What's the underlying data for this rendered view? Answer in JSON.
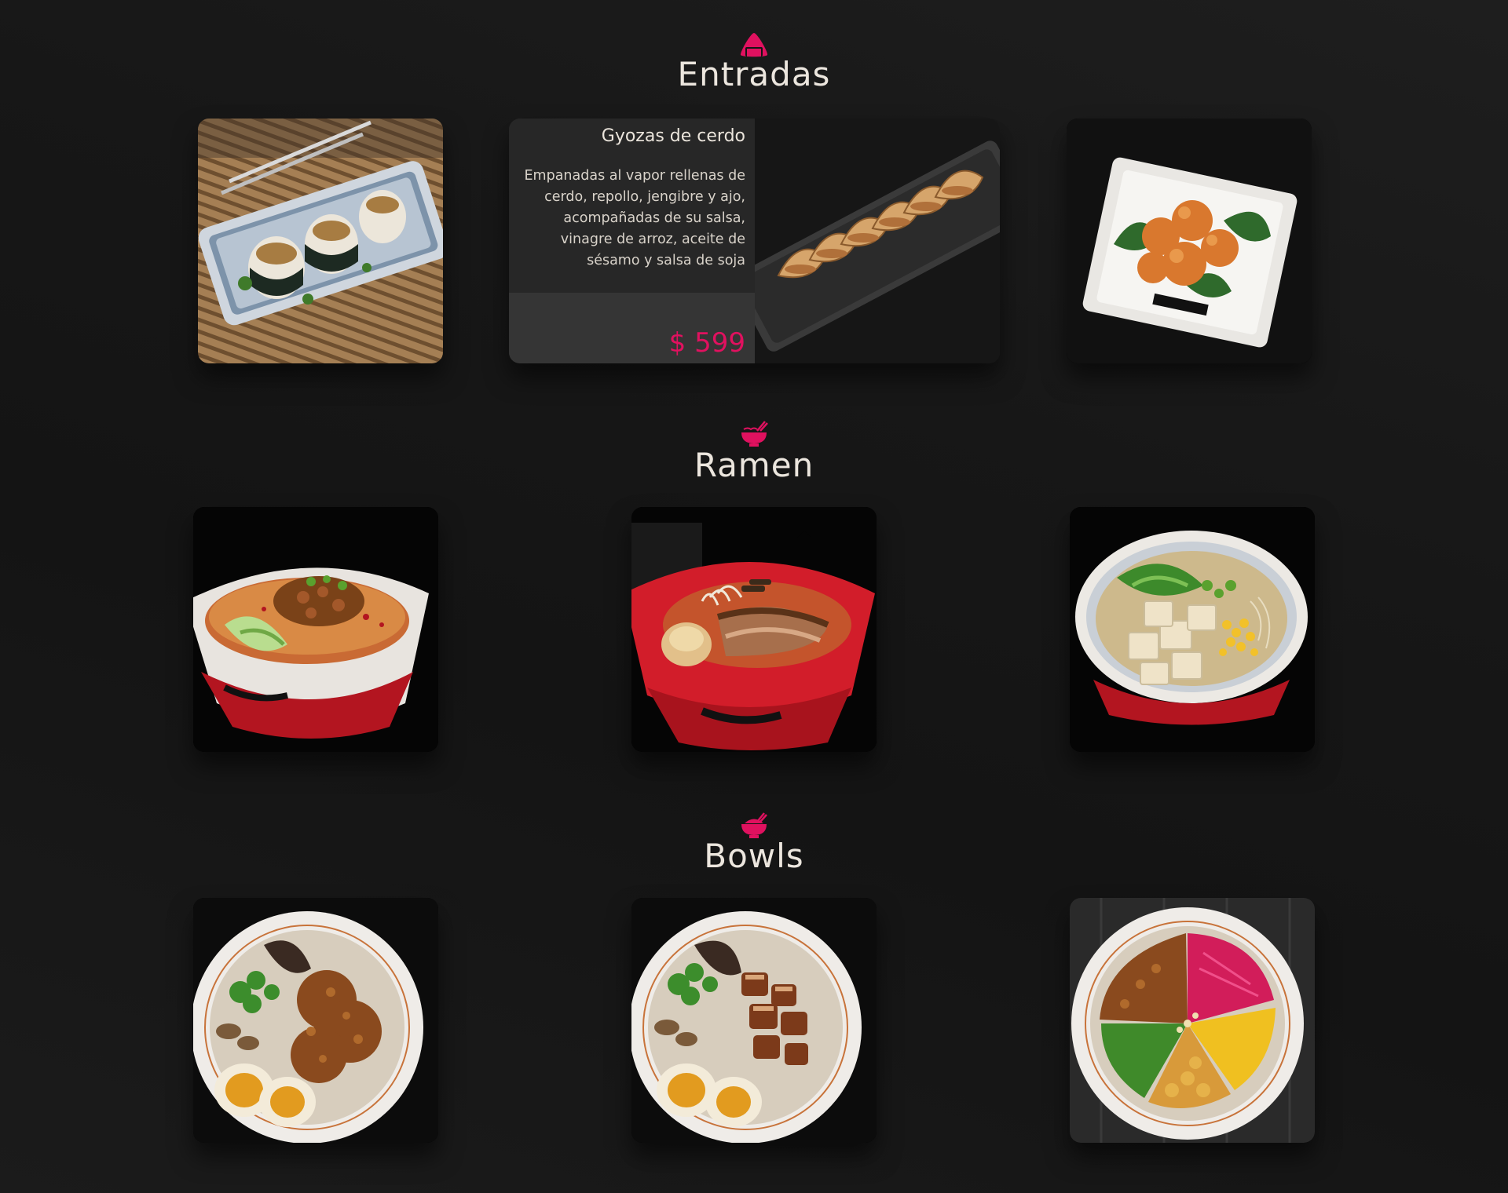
{
  "theme": {
    "accent": "#e0115f",
    "background": "#161616",
    "text": "#ece6de"
  },
  "sections": [
    {
      "title": "Entradas",
      "icon": "onigiri-icon",
      "items": [
        {
          "image": "onigiri-plate-photo"
        },
        {
          "image": "gyoza-plate-photo",
          "name": "Gyozas de cerdo",
          "description": "Empanadas al vapor rellenas de cerdo, repollo, jengibre y ajo, acompañadas de su salsa, vinagre de arroz, aceite de sésamo y salsa de soja",
          "price": "$ 599"
        },
        {
          "image": "fried-shrimp-plate-photo"
        }
      ]
    },
    {
      "title": "Ramen",
      "icon": "ramen-bowl-icon",
      "items": [
        {
          "image": "spicy-ramen-photo"
        },
        {
          "image": "tonkotsu-ramen-photo"
        },
        {
          "image": "tofu-ramen-photo"
        }
      ]
    },
    {
      "title": "Bowls",
      "icon": "rice-bowl-icon",
      "items": [
        {
          "image": "ground-meat-egg-bowl-photo"
        },
        {
          "image": "pork-belly-egg-bowl-photo"
        },
        {
          "image": "colorful-veggie-bowl-photo"
        }
      ]
    }
  ]
}
